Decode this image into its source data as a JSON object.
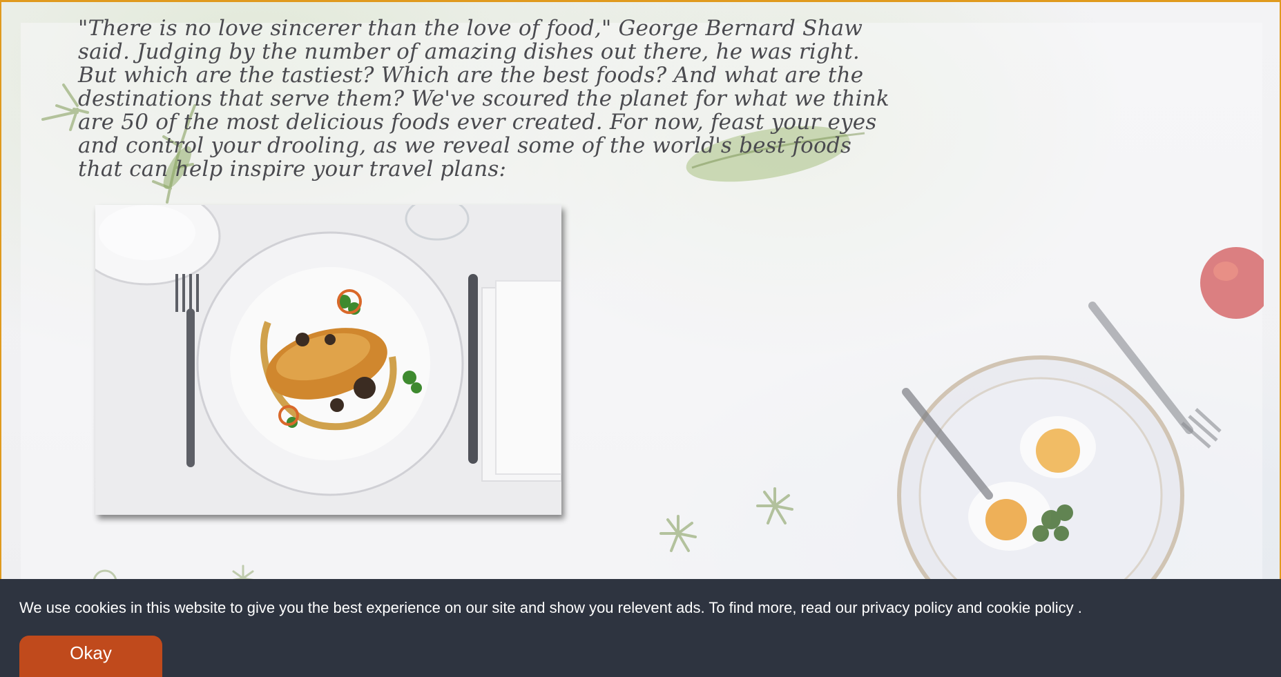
{
  "article": {
    "quote": "\"There is no love sincerer than the love of food,\" George Bernard Shaw said. Judging by the number of amazing dishes out there, he was right. But which are the tastiest? Which are the best foods? And what are the destinations that serve them? We've scoured the planet for what we think are 50 of the most delicious foods ever created. For now, feast your eyes and control your drooling, as we reveal some of the world's best foods that can help inspire your travel plans:"
  },
  "cookie_banner": {
    "text_before": "We use cookies in this website to give you the best experience on our site and show you relevent ads. To find more, read our ",
    "privacy_link": "privacy policy",
    "and_text": " and ",
    "cookie_link": "cookie policy",
    "text_after": " .",
    "okay_label": "Okay"
  },
  "colors": {
    "frame_border": "#e09a1e",
    "cookie_bar_bg": "#2e3440",
    "okay_button_bg": "#c04a1c"
  }
}
